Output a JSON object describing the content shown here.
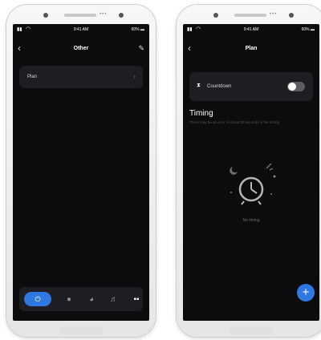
{
  "left_screen": {
    "status": {
      "time": "9:41 AM",
      "battery": "60%"
    },
    "title": "Other",
    "rows": [
      {
        "label": "Plan"
      }
    ],
    "tabbar": {
      "items": [
        "power-icon",
        "bulb-icon",
        "palette-icon",
        "music-icon",
        "grid-icon"
      ]
    }
  },
  "right_screen": {
    "status": {
      "time": "9:41 AM",
      "battery": "60%"
    },
    "title": "Plan",
    "countdown": {
      "label": "Countdown",
      "enabled": false
    },
    "timing": {
      "title": "Timing",
      "hint": "There may be an error of about 30 seconds in the timing",
      "empty_label": "No timing"
    },
    "fab_label": "+"
  },
  "colors": {
    "accent": "#2f78e0",
    "screen_bg": "#0c0c0f",
    "card_bg": "#1d1d22"
  }
}
